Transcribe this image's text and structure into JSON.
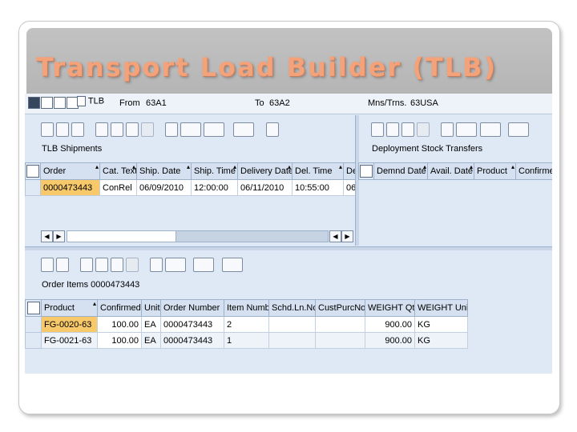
{
  "slide_title": "Transport Load Builder (TLB)",
  "topbar": {
    "tlb_label": "TLB",
    "from_label": "From",
    "from_value": "63A1",
    "to_label": "To",
    "to_value": "63A2",
    "mns_label": "Mns/Trns.",
    "mns_value": "63USA"
  },
  "shipments": {
    "title": "TLB Shipments",
    "columns": [
      "Order",
      "Cat. Text",
      "Ship. Date",
      "Ship. Time",
      "Delivery Date",
      "Del. Time",
      "De"
    ],
    "rows": [
      [
        "0000473443",
        "ConRel",
        "06/09/2010",
        "12:00:00",
        "06/11/2010",
        "10:55:00",
        "06"
      ]
    ]
  },
  "deployment": {
    "title": "Deployment Stock Transfers",
    "columns": [
      "Demnd Date",
      "Avail. Date",
      "Product",
      "Confirme"
    ]
  },
  "order_items": {
    "title": "Order Items 0000473443",
    "columns": [
      "Product",
      "Confirmed",
      "Unit",
      "Order Number",
      "Item Number",
      "Schd.Ln.No",
      "CustPurcNo",
      "WEIGHT Qty",
      "WEIGHT Unit"
    ],
    "rows": [
      [
        "FG-0020-63",
        "100.00",
        "EA",
        "0000473443",
        "2",
        "",
        "",
        "900.00",
        "KG"
      ],
      [
        "FG-0021-63",
        "100.00",
        "EA",
        "0000473443",
        "1",
        "",
        "",
        "900.00",
        "KG"
      ]
    ]
  },
  "icons": {
    "toolbar": [
      "create-icon",
      "delete-icon",
      "refresh-icon",
      "select-icon",
      "filter-icon",
      "find-icon",
      "sort-icon",
      "print-icon",
      "export-icon",
      "layout-icon",
      "grid-icon",
      "detail-icon"
    ]
  },
  "colors": {
    "title": "#f3a27a",
    "banner": "#bcbcbc",
    "selection": "#f8c96a",
    "sap_bg": "#dfe9f5"
  }
}
